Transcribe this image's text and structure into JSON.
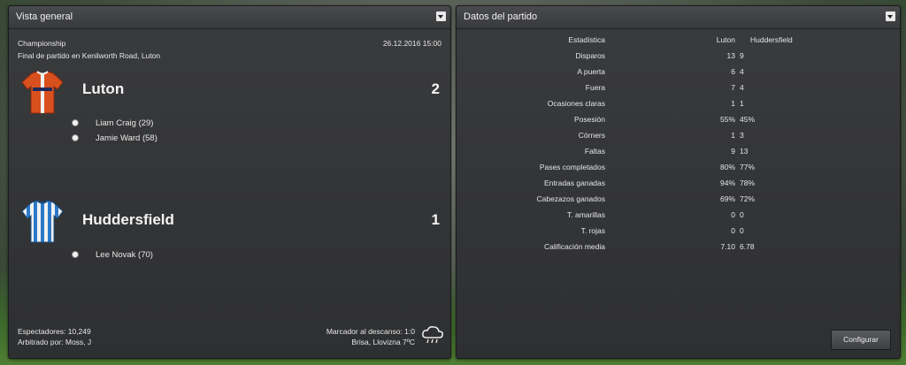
{
  "overview": {
    "title": "Vista general",
    "competition": "Championship",
    "datetime": "26.12.2016 15:00",
    "result_line": "Final de partido en Kenilworth Road, Luton",
    "home": {
      "name": "Luton",
      "score": "2",
      "scorers": [
        "Liam Craig (29)",
        "Jamie Ward (58)"
      ]
    },
    "away": {
      "name": "Huddersfield",
      "score": "1",
      "scorers": [
        "Lee Novak (70)"
      ]
    },
    "attendance": "Espectadores: 10,249",
    "referee": "Arbitrado por: Moss, J",
    "halftime": "Marcador al descanso: 1:0",
    "weather": "Brisa, Llovizna 7ºC",
    "weather_icon": "rain-cloud-icon"
  },
  "stats": {
    "title": "Datos del partido",
    "col_stat": "Estadística",
    "col_home": "Luton",
    "col_away": "Huddersfield",
    "rows": [
      {
        "label": "Disparos",
        "home": "13",
        "away": "9"
      },
      {
        "label": "A puerta",
        "home": "6",
        "away": "4"
      },
      {
        "label": "Fuera",
        "home": "7",
        "away": "4"
      },
      {
        "label": "Ocasiones claras",
        "home": "1",
        "away": "1"
      },
      {
        "label": "Posesión",
        "home": "55%",
        "away": "45%"
      },
      {
        "label": "Córners",
        "home": "1",
        "away": "3"
      },
      {
        "label": "Faltas",
        "home": "9",
        "away": "13"
      },
      {
        "label": "Pases completados",
        "home": "80%",
        "away": "77%"
      },
      {
        "label": "Entradas ganadas",
        "home": "94%",
        "away": "78%"
      },
      {
        "label": "Cabezazos ganados",
        "home": "69%",
        "away": "72%"
      },
      {
        "label": "T. amarillas",
        "home": "0",
        "away": "0"
      },
      {
        "label": "T. rojas",
        "home": "0",
        "away": "0"
      },
      {
        "label": "Calificación media",
        "home": "7.10",
        "away": "6.78"
      }
    ],
    "configure_label": "Configurar"
  }
}
